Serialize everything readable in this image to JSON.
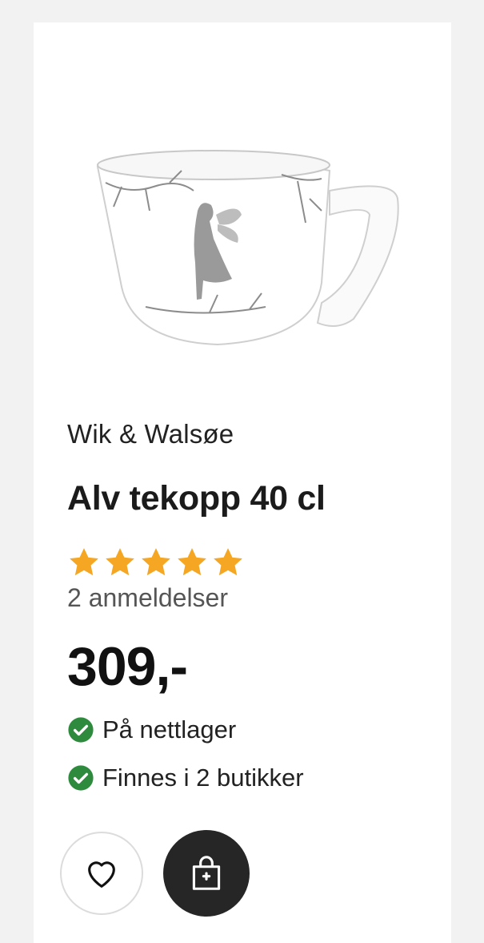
{
  "product": {
    "brand": "Wik & Walsøe",
    "title": "Alv tekopp 40 cl",
    "rating": 5,
    "rating_max": 5,
    "reviews": "2 anmeldelser",
    "price": "309,-",
    "availability": [
      {
        "label": "På nettlager",
        "icon": "check-circle-icon"
      },
      {
        "label": "Finnes i 2 butikker",
        "icon": "check-circle-icon"
      }
    ]
  },
  "actions": {
    "favorite_icon": "heart-icon",
    "cart_icon": "shopping-bag-icon"
  },
  "colors": {
    "star": "#f5a623",
    "check": "#2e8b3e",
    "cart_button": "#262626"
  }
}
